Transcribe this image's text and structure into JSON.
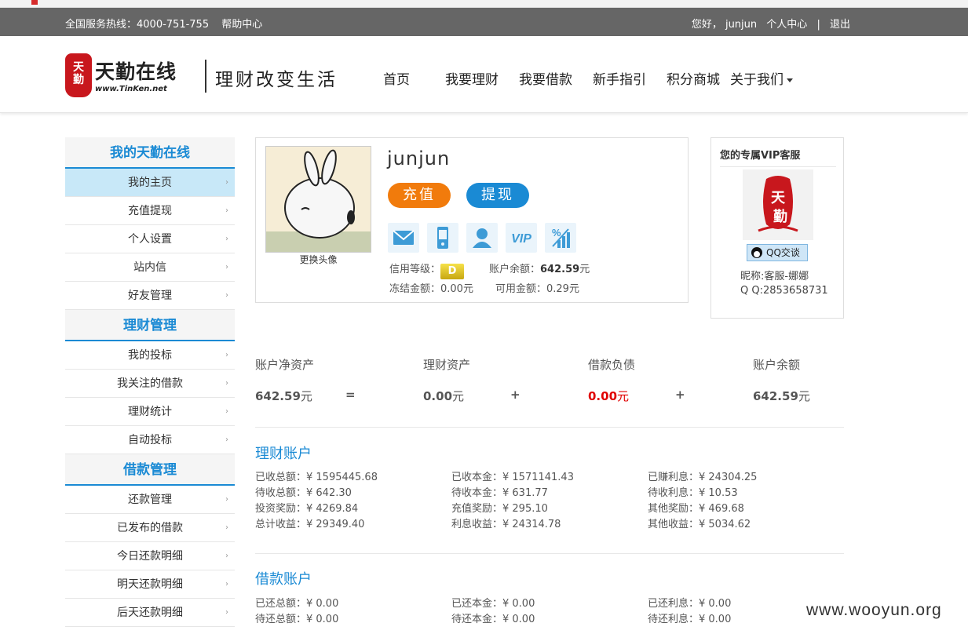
{
  "topbar": {
    "hotline": "全国服务热线：4000-751-755",
    "help": "帮助中心",
    "greeting": "您好， junjun",
    "user_center": "个人中心",
    "separator": "|",
    "logout": "退出"
  },
  "logo": {
    "name": "天勤在线",
    "url": "www.TinKen.net",
    "seal_text": "天勤"
  },
  "slogan": "理财改变生活",
  "nav": {
    "home": "首页",
    "invest": "我要理财",
    "borrow": "我要借款",
    "guide": "新手指引",
    "mall": "积分商城",
    "about": "关于我们"
  },
  "sidebar": {
    "sections": [
      {
        "title": "我的天勤在线",
        "items": [
          "我的主页",
          "充值提现",
          "个人设置",
          "站内信",
          "好友管理"
        ]
      },
      {
        "title": "理财管理",
        "items": [
          "我的投标",
          "我关注的借款",
          "理财统计",
          "自动投标"
        ]
      },
      {
        "title": "借款管理",
        "items": [
          "还款管理",
          "已发布的借款",
          "今日还款明细",
          "明天还款明细",
          "后天还款明细"
        ]
      }
    ],
    "active_item": "我的主页",
    "arrow": "›"
  },
  "profile": {
    "username": "junjun",
    "change_avatar": "更换头像",
    "recharge": "充值",
    "withdraw": "提现",
    "icons": [
      "mail-icon",
      "phone-icon",
      "user-icon",
      "vip-icon",
      "percent-chart-icon"
    ],
    "vip_text": "VIP",
    "credit_label": "信用等级：",
    "credit_grade": "D",
    "balance_label": "账户余额：",
    "balance_value": "642.59",
    "unit": "元",
    "frozen": "冻结金额：0.00元",
    "available": "可用金额：0.29元"
  },
  "vip": {
    "title": "您的专属VIP客服",
    "qq_button": "QQ交谈",
    "nickname": "昵称:客服-娜娜",
    "qq": "Q  Q:2853658731"
  },
  "summary": {
    "labels": [
      "账户净资产",
      "理财资产",
      "借款负债",
      "账户余额"
    ],
    "values": [
      "642.59",
      "0.00",
      "0.00",
      "642.59"
    ],
    "unit": "元",
    "operators": [
      "=",
      "+",
      "+"
    ],
    "negative_color": "#e00000"
  },
  "invest_account": {
    "title": "理财账户",
    "rows": [
      [
        "已收总额：¥ 1595445.68",
        "已收本金：¥ 1571141.43",
        "已赚利息：¥ 24304.25"
      ],
      [
        "待收总额：¥ 642.30",
        "待收本金：¥ 631.77",
        "待收利息：¥ 10.53"
      ],
      [
        "投资奖励：¥ 4269.84",
        "充值奖励：¥ 295.10",
        "其他奖励：¥ 469.68"
      ],
      [
        "总计收益：¥ 29349.40",
        "利息收益：¥ 24314.78",
        "其他收益：¥ 5034.62"
      ]
    ]
  },
  "loan_account": {
    "title": "借款账户",
    "rows": [
      [
        "已还总额：¥ 0.00",
        "已还本金：¥ 0.00",
        "已还利息：¥ 0.00"
      ],
      [
        "待还总额：¥ 0.00",
        "待还本金：¥ 0.00",
        "待还利息：¥ 0.00"
      ]
    ]
  },
  "watermark": "www.wooyun.org",
  "colors": {
    "accent": "#1a8ad4",
    "orange": "#f17b0c",
    "topbar": "#666666",
    "active_item": "#c8e8f8"
  }
}
